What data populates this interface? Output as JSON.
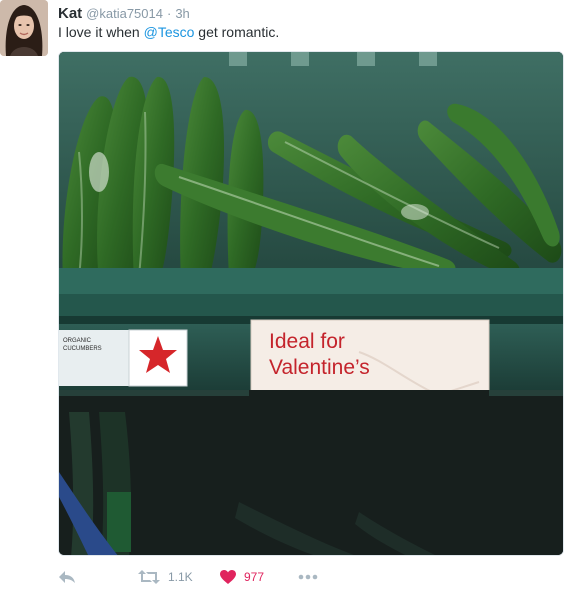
{
  "tweet": {
    "name": "Kat",
    "handle": "@katia75014",
    "dot": "·",
    "time": "3h",
    "text_before": "I love it when ",
    "mention": "@Tesco",
    "text_after": " get romantic."
  },
  "photo": {
    "sign_line1": "Ideal for",
    "sign_line2": "Valentine’s",
    "left_label_line1": "ORGANIC",
    "left_label_line2": "CUCUMBERS"
  },
  "actions": {
    "retweets": "1.1K",
    "likes": "977"
  },
  "colors": {
    "link": "#1b95e0",
    "like": "#e0245e",
    "muted": "#8899a6"
  }
}
